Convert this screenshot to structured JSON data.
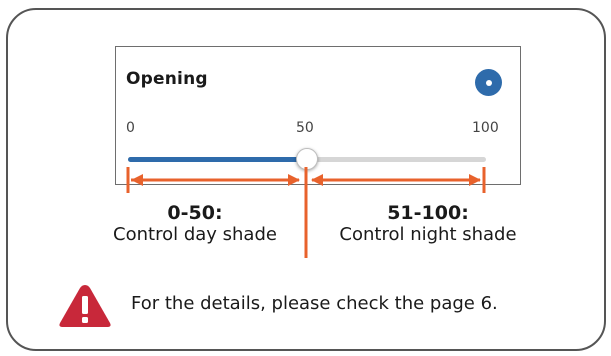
{
  "card": {
    "title": "Opening",
    "toggle_icon": "radio-dot-icon",
    "accent_color": "#2e6bab"
  },
  "slider": {
    "min_label": "0",
    "mid_label": "50",
    "max_label": "100",
    "min": 0,
    "max": 100,
    "value": 50
  },
  "annotation": {
    "arrow_color": "#e8622c",
    "left": {
      "range": "0-50:",
      "description": "Control day shade"
    },
    "right": {
      "range": "51-100:",
      "description": "Control night shade"
    }
  },
  "note": {
    "icon": "warning-icon",
    "icon_color": "#c8283a",
    "text": "For the details, please check the page 6."
  }
}
